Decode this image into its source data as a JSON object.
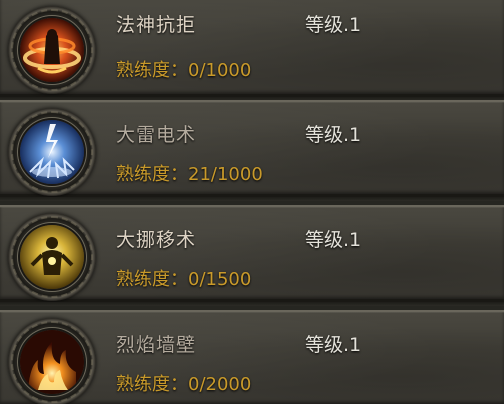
{
  "skills": [
    {
      "name": "法神抗拒",
      "level": "等级.1",
      "proficiency": "熟练度：0/1000",
      "icon": "fire-ring-mage-icon",
      "name_color": "#e7dccb"
    },
    {
      "name": "大雷电术",
      "level": "等级.1",
      "proficiency": "熟练度：21/1000",
      "icon": "lightning-icon",
      "name_color": "#b8ae9f"
    },
    {
      "name": "大挪移术",
      "level": "等级.1",
      "proficiency": "熟练度：0/1500",
      "icon": "teleport-figure-icon",
      "name_color": "#e7dccb"
    },
    {
      "name": "烈焰墙壁",
      "level": "等级.1",
      "proficiency": "熟练度：0/2000",
      "icon": "flame-wall-icon",
      "name_color": "#b8ae9f"
    }
  ],
  "colors": {
    "proficiency_text": "#c99a2a",
    "level_text": "#e4e2da"
  }
}
